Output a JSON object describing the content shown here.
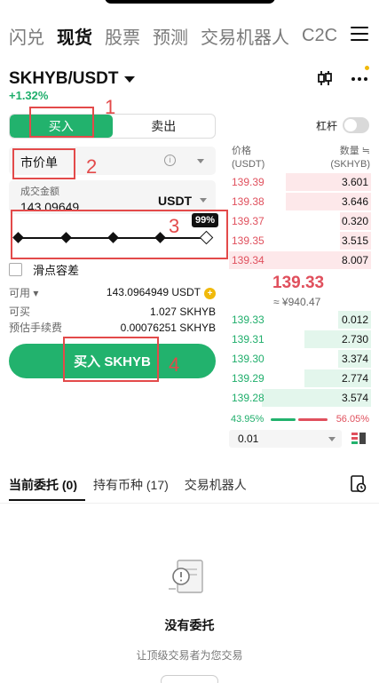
{
  "nav": {
    "tabs": [
      "闪兑",
      "现货",
      "股票",
      "预测",
      "交易机器人",
      "C2C"
    ],
    "active_index": 1
  },
  "header": {
    "pair": "SKHYB/USDT",
    "change": "+1.32%"
  },
  "order_form": {
    "buy_label": "买入",
    "sell_label": "卖出",
    "leverage_label": "杠杆",
    "leverage_on": false,
    "order_type": "市价单",
    "amount_placeholder": "成交金额",
    "amount_value": "143.09649",
    "amount_unit": "USDT",
    "slider_percent": 99,
    "slider_label": "99%",
    "slippage_label": "滑点容差",
    "available_label": "可用",
    "available_value": "143.0964949 USDT",
    "can_buy_label": "可买",
    "can_buy_value": "1.027 SKHYB",
    "fee_label": "预估手续费",
    "fee_value": "0.00076251 SKHYB",
    "submit_label": "买入 SKHYB"
  },
  "order_book": {
    "price_header": "价格",
    "price_unit": "(USDT)",
    "qty_header": "数量 ≒",
    "qty_unit": "(SKHYB)",
    "asks": [
      {
        "price": "139.39",
        "qty": "3.601",
        "depth": 0.6
      },
      {
        "price": "139.38",
        "qty": "3.646",
        "depth": 0.6
      },
      {
        "price": "139.37",
        "qty": "0.320",
        "depth": 0.22
      },
      {
        "price": "139.35",
        "qty": "3.515",
        "depth": 0.22
      },
      {
        "price": "139.34",
        "qty": "8.007",
        "depth": 1.0
      }
    ],
    "last_price": "139.33",
    "last_fiat": "≈ ¥940.47",
    "bids": [
      {
        "price": "139.33",
        "qty": "0.012",
        "depth": 0.23
      },
      {
        "price": "139.31",
        "qty": "2.730",
        "depth": 0.47
      },
      {
        "price": "139.30",
        "qty": "3.374",
        "depth": 0.23
      },
      {
        "price": "139.29",
        "qty": "2.774",
        "depth": 0.47
      },
      {
        "price": "139.28",
        "qty": "3.574",
        "depth": 0.77
      }
    ],
    "buy_ratio": "43.95%",
    "sell_ratio": "56.05%",
    "depth_value": "0.01"
  },
  "bottom_tabs": {
    "tabs": [
      "当前委托 (0)",
      "持有币种 (17)",
      "交易机器人"
    ],
    "active_index": 0
  },
  "empty": {
    "title": "没有委托",
    "subtitle": "让顶级交易者为您交易"
  },
  "annotations": [
    "1",
    "2",
    "3",
    "4"
  ],
  "colors": {
    "buy_green": "#22b26d",
    "sell_red": "#e0505d",
    "annotation_red": "#e34a4a"
  }
}
